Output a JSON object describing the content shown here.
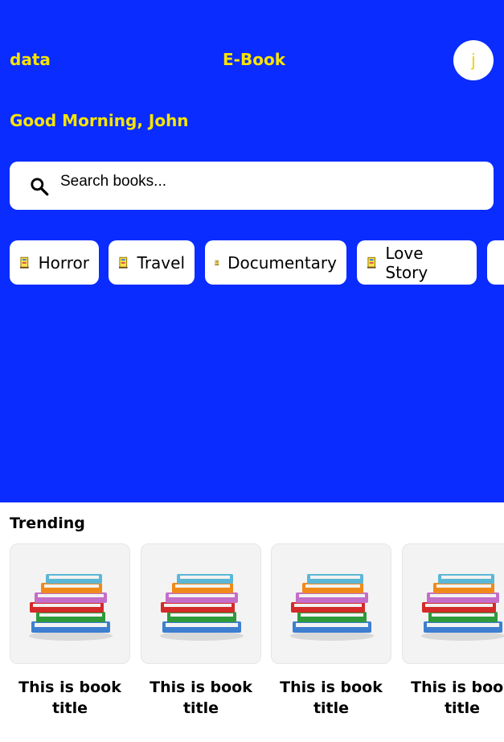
{
  "header": {
    "left_label": "data",
    "center_title": "E-Book",
    "avatar_initial": "j",
    "greeting": "Good Morning, John"
  },
  "search": {
    "placeholder": "Search books...",
    "icon": "search-icon"
  },
  "categories": [
    {
      "label": "Horror",
      "icon": "book-icon"
    },
    {
      "label": "Travel",
      "icon": "book-icon"
    },
    {
      "label": "Documentary",
      "icon": "book-icon"
    },
    {
      "label": "Love Story",
      "icon": "book-icon"
    },
    {
      "label": "",
      "icon": "book-icon"
    }
  ],
  "trending": {
    "title": "Trending",
    "books": [
      {
        "title": "This is book title",
        "image": "book-stack-image"
      },
      {
        "title": "This is book title",
        "image": "book-stack-image"
      },
      {
        "title": "This is book title",
        "image": "book-stack-image"
      },
      {
        "title": "This is book title",
        "image": "book-stack-image"
      }
    ]
  },
  "colors": {
    "hero_bg": "#0a2cff",
    "accent_yellow": "#f7e400",
    "card_bg": "#ffffff"
  }
}
